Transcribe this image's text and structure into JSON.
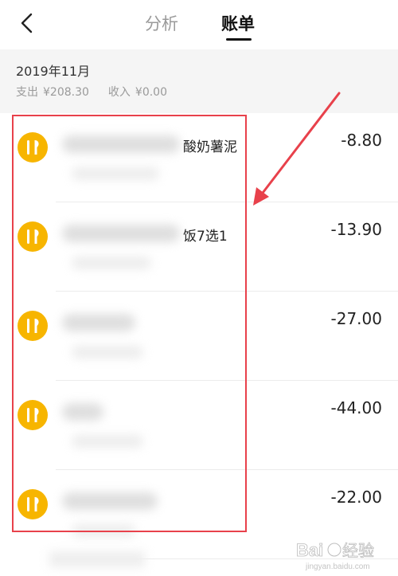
{
  "header": {
    "back_icon": "chevron-left-icon",
    "tabs": [
      {
        "label": "分析",
        "active": false
      },
      {
        "label": "账单",
        "active": true
      }
    ]
  },
  "month": {
    "title": "2019年11月",
    "expense_label": "支出",
    "expense_value": "¥208.30",
    "income_label": "收入",
    "income_value": "¥0.00"
  },
  "transactions": [
    {
      "icon": "utensils-icon",
      "title_visible": "酸奶薯泥",
      "amount": "-8.80"
    },
    {
      "icon": "utensils-icon",
      "title_visible": "饭7选1",
      "amount": "-13.90"
    },
    {
      "icon": "utensils-icon",
      "title_visible": "",
      "amount": "-27.00"
    },
    {
      "icon": "utensils-icon",
      "title_visible": "",
      "amount": "-44.00"
    },
    {
      "icon": "utensils-icon",
      "title_visible": "",
      "amount": "-22.00"
    }
  ],
  "annotation": {
    "color": "#e8414b"
  },
  "colors": {
    "category_icon": "#f7b500",
    "active_tab": "#111111",
    "inactive_tab": "#9a9a9a"
  },
  "watermark": {
    "text": "Bai 经验",
    "url": "jingyan.baidu.com"
  }
}
